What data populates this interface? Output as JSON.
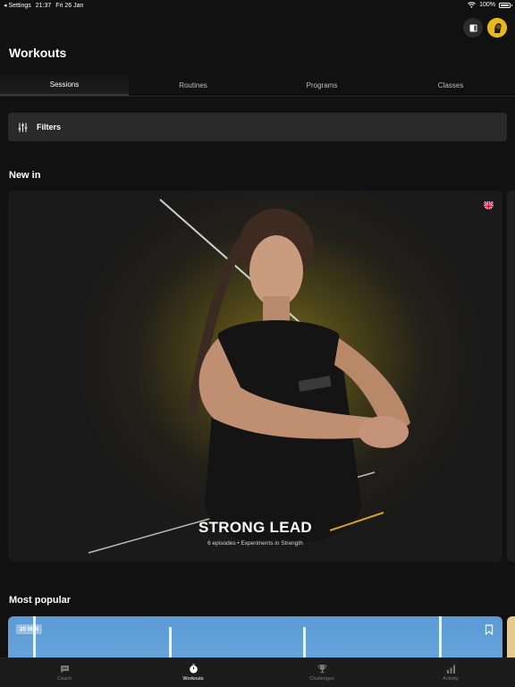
{
  "status_bar": {
    "back_label": "◂ Settings",
    "time": "21:37",
    "date": "Fri 26 Jan",
    "battery": "100%"
  },
  "header": {
    "title": "Workouts"
  },
  "tabs": [
    {
      "label": "Sessions",
      "active": true
    },
    {
      "label": "Routines",
      "active": false
    },
    {
      "label": "Programs",
      "active": false
    },
    {
      "label": "Classes",
      "active": false
    }
  ],
  "filters": {
    "label": "Filters"
  },
  "sections": {
    "new_in": "New in",
    "most_popular": "Most popular"
  },
  "hero": {
    "title": "STRONG LEAD",
    "subtitle": "6 episodes • Experiments in Strength",
    "language_flag": "uk-flag-icon"
  },
  "popular_card": {
    "duration": "20 MIN"
  },
  "tab_bar": [
    {
      "label": "Coach",
      "icon": "chat-bubble-icon",
      "active": false
    },
    {
      "label": "Workouts",
      "icon": "stopwatch-icon",
      "active": true
    },
    {
      "label": "Challenges",
      "icon": "trophy-icon",
      "active": false
    },
    {
      "label": "Activity",
      "icon": "bar-chart-icon",
      "active": false
    }
  ],
  "colors": {
    "background": "#111111",
    "card": "#2a2a2a",
    "accent_yellow": "#e8b819"
  }
}
